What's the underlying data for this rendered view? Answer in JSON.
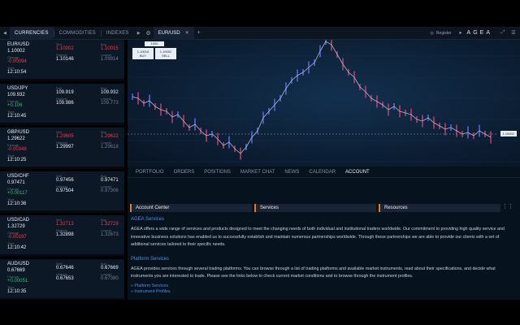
{
  "topbar": {
    "tabs": [
      {
        "label": "CURRENCIES",
        "active": true
      },
      {
        "label": "COMMODITIES",
        "active": false
      },
      {
        "label": "INDEXES",
        "active": false
      }
    ],
    "chart_tab": "EUR/USD",
    "register": "Register",
    "logo": "AGEA"
  },
  "instruments": [
    {
      "symbol": "EUR/USD",
      "price": "1.10002",
      "change": "-0.00094",
      "change_dir": "down",
      "time": "12:10:54",
      "sell": "1.10002",
      "highest": "1.10146",
      "buy": "1.10015",
      "lowest": "1.09914"
    },
    {
      "symbol": "USD/JPY",
      "price": "109.932",
      "change": "+0.106",
      "change_dir": "up",
      "time": "12:10:45",
      "sell": "109.919",
      "highest": "109.986",
      "buy": "109.932",
      "lowest": "109.773"
    },
    {
      "symbol": "GBP/USD",
      "price": "1.29622",
      "change": "-0.00348",
      "change_dir": "down",
      "time": "12:10:25",
      "sell": "1.29605",
      "highest": "1.29997",
      "buy": "1.29622",
      "lowest": "1.29618"
    },
    {
      "symbol": "USD/CHF",
      "price": "0.97471",
      "change": "+0.00117",
      "change_dir": "up",
      "time": "12:10:36",
      "sell": "0.97456",
      "highest": "0.97504",
      "buy": "0.97471",
      "lowest": "0.97306"
    },
    {
      "symbol": "USD/CAD",
      "price": "1.32729",
      "change": "-0.00197",
      "change_dir": "down",
      "time": "12:10:42",
      "sell": "1.32713",
      "highest": "1.32898",
      "buy": "1.32729",
      "lowest": "1.32673"
    },
    {
      "symbol": "AUD/USD",
      "price": "0.67669",
      "change": "+0.00051",
      "change_dir": "up",
      "time": "12:10:35",
      "sell": "0.67646",
      "highest": "0.67653",
      "buy": "0.67669",
      "lowest": "0.67380"
    }
  ],
  "labels": {
    "change": "Change",
    "time": "Time",
    "sell": "Sell",
    "highest": "Highest",
    "buy": "Buy",
    "lowest": "Lowest"
  },
  "trade": {
    "lot": "1000",
    "buy_price": "1.10015",
    "buy_label": "BUY",
    "sell_price": "1.10002",
    "sell_label": "SELL"
  },
  "chart": {
    "last_price": "1.10002"
  },
  "panel": {
    "tabs": [
      {
        "label": "PORTFOLIO",
        "active": false
      },
      {
        "label": "ORDERS",
        "active": false
      },
      {
        "label": "POSITIONS",
        "active": false
      },
      {
        "label": "MARKET CHAT",
        "active": false
      },
      {
        "label": "NEWS",
        "active": false
      },
      {
        "label": "CALENDAR",
        "active": false
      },
      {
        "label": "ACCOUNT",
        "active": true
      }
    ],
    "account_buttons": [
      "Account Center",
      "Services",
      "Resources"
    ],
    "sections": [
      {
        "title": "AGEA Services",
        "text": "AGEA offers a wide range of services and products designed to meet the changing needs of both individual and institutional traders worldwide. Our commitment to providing high quality service and innovative business solutions has enabled us to successfully establish and maintain numerous partnerships worldwide. Through these partnerships we are able to provide our clients with a set of additional services tailored to their specific needs."
      },
      {
        "title": "Platform Services",
        "text": "AGEA provides services through several trading platforms. You can browse through a list of trading platforms and available market instruments, read about their specifications, and decide what instruments you are interested to trade. Please see the links below to check current market conditions and to browse through the instrument profiles."
      }
    ],
    "links": [
      "» Platform Services",
      "» Instrument Profiles"
    ]
  },
  "colors": {
    "up": "#21c26a",
    "down": "#ef3a4c",
    "accent": "#4a90e2",
    "bull_candle": "#5a6cf0",
    "bear_candle": "#d23a78"
  }
}
